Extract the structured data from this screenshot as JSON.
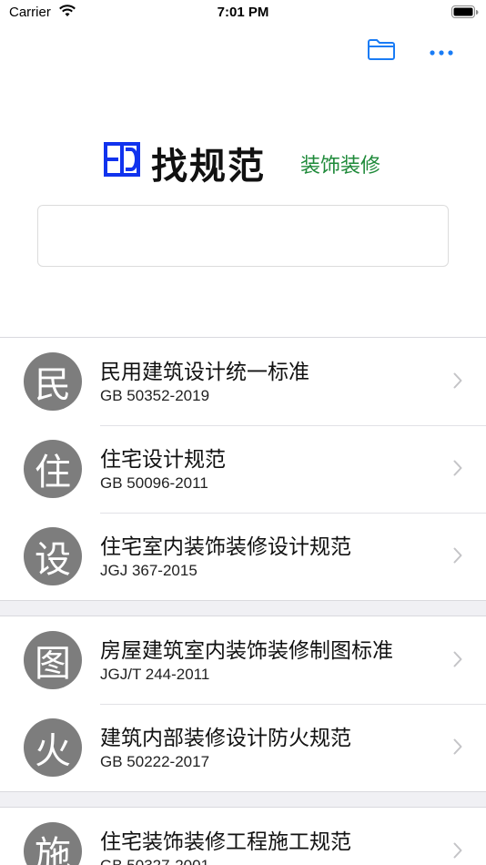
{
  "status_bar": {
    "carrier": "Carrier",
    "time": "7:01 PM"
  },
  "toolbar": {
    "folder_icon": "folder-icon",
    "more_icon": "ellipsis-icon",
    "accent": "#1a7cf5"
  },
  "logo": {
    "mark_icon": "book-logo-icon",
    "title": "找规范",
    "subtitle": "装饰装修",
    "mark_color": "#1133ee",
    "subtitle_color": "#1f8a3a"
  },
  "search": {
    "placeholder": ""
  },
  "sections": [
    {
      "items": [
        {
          "glyph": "民",
          "title": "民用建筑设计统一标准",
          "code": "GB 50352-2019"
        },
        {
          "glyph": "住",
          "title": "住宅设计规范",
          "code": "GB 50096-2011"
        },
        {
          "glyph": "设",
          "title": "住宅室内装饰装修设计规范",
          "code": "JGJ 367-2015"
        }
      ]
    },
    {
      "items": [
        {
          "glyph": "图",
          "title": "房屋建筑室内装饰装修制图标准",
          "code": "JGJ/T 244-2011"
        },
        {
          "glyph": "火",
          "title": "建筑内部装修设计防火规范",
          "code": "GB 50222-2017"
        }
      ]
    },
    {
      "items": [
        {
          "glyph": "施",
          "title": "住宅装饰装修工程施工规范",
          "code": "GB 50327-2001"
        }
      ]
    }
  ]
}
